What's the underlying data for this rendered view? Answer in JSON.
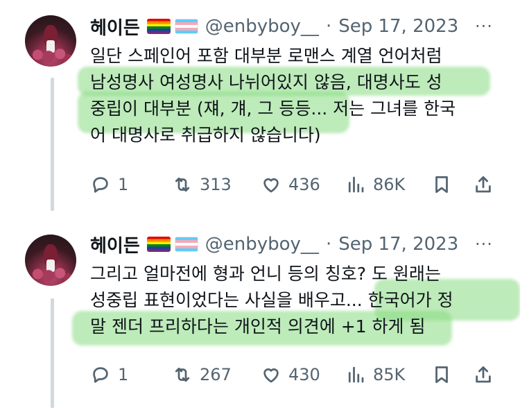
{
  "tweets": [
    {
      "author_name": "헤이든",
      "handle": "@enbyboy__",
      "separator": "·",
      "date": "Sep 17, 2023",
      "more": "···",
      "lines": [
        "일단 스페인어 포함 대부분 로맨스 계열 언어처럼",
        "남성명사 여성명사 나뉘어있지 않음, 대명사도 성",
        "중립이 대부분 (쟤, 걔, 그 등등... 저는 그녀를 한국",
        "어 대명사로 취급하지 않습니다)"
      ],
      "replies": "1",
      "retweets": "313",
      "likes": "436",
      "views": "86K"
    },
    {
      "author_name": "헤이든",
      "handle": "@enbyboy__",
      "separator": "·",
      "date": "Sep 17, 2023",
      "more": "···",
      "lines": [
        "그리고 얼마전에 형과 언니 등의 칭호? 도 원래는",
        "성중립 표현이었다는 사실을 배우고... 한국어가 정",
        "말 젠더 프리하다는 개인적 의견에 +1 하게 됨"
      ],
      "replies": "1",
      "retweets": "267",
      "likes": "430",
      "views": "85K"
    }
  ],
  "colors": {
    "highlight": "#86db7f",
    "thread_line": "#cfd9de",
    "secondary_text": "#536471"
  },
  "icons": [
    "reply-icon",
    "retweet-icon",
    "like-icon",
    "views-icon",
    "bookmark-icon",
    "share-icon",
    "more-icon"
  ]
}
